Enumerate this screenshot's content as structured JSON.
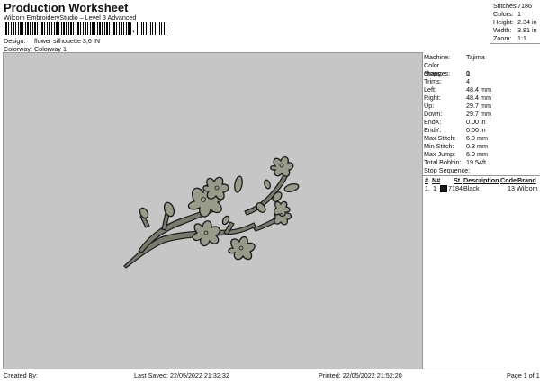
{
  "header": {
    "title": "Production Worksheet",
    "subtitle": "Wilcom EmbroideryStudio – Level 3 Advanced",
    "barcode_suffix": ",",
    "design_label": "Design:",
    "design_value": "flower silhouette 3,6 IN",
    "colorway_label": "Colorway:",
    "colorway_value": "Colorway 1"
  },
  "summary": {
    "stitches_label": "Stitches:",
    "stitches": "7186",
    "colors_label": "Colors:",
    "colors": "1",
    "height_label": "Height:",
    "height": "2.34 in",
    "width_label": "Width:",
    "width": "3.81 in",
    "zoom_label": "Zoom:",
    "zoom": "1:1"
  },
  "properties": [
    {
      "label": "Machine:",
      "value": "Tajima"
    },
    {
      "label": "Color changes:",
      "value": "0"
    },
    {
      "label": "Stops:",
      "value": "1"
    },
    {
      "label": "Trims:",
      "value": "4"
    },
    {
      "label": "Left:",
      "value": "48.4 mm"
    },
    {
      "label": "Right:",
      "value": "48.4 mm"
    },
    {
      "label": "Up:",
      "value": "29.7 mm"
    },
    {
      "label": "Down:",
      "value": "29.7 mm"
    },
    {
      "label": "EndX:",
      "value": "0.00 in"
    },
    {
      "label": "EndY:",
      "value": "0.00 in"
    },
    {
      "label": "Max Stitch:",
      "value": "6.0 mm"
    },
    {
      "label": "Min Stitch:",
      "value": "0.3 mm"
    },
    {
      "label": "Max Jump:",
      "value": "6.0 mm"
    },
    {
      "label": "Total Bobbin:",
      "value": "19.54ft"
    }
  ],
  "stop_sequence": {
    "title": "Stop Sequence:",
    "headers": [
      "#",
      "N#",
      "St.",
      "Description",
      "Code",
      "Brand"
    ],
    "rows": [
      {
        "index": "1.",
        "needle": "1",
        "stitches": "7184",
        "description": "Black",
        "code": "13",
        "brand": "Wilcom",
        "swatch": "#1a1a1a"
      }
    ]
  },
  "footer": {
    "created_by": "Created By:",
    "last_saved": "Last Saved: 22/05/2022 21:32:32",
    "printed": "Printed: 22/05/2022 21:52:20",
    "page": "Page 1 of 1"
  },
  "colors": {
    "canvas_bg": "#c6c6c6",
    "thread": "#1a1a1a",
    "fill": "#9a9a8a"
  }
}
